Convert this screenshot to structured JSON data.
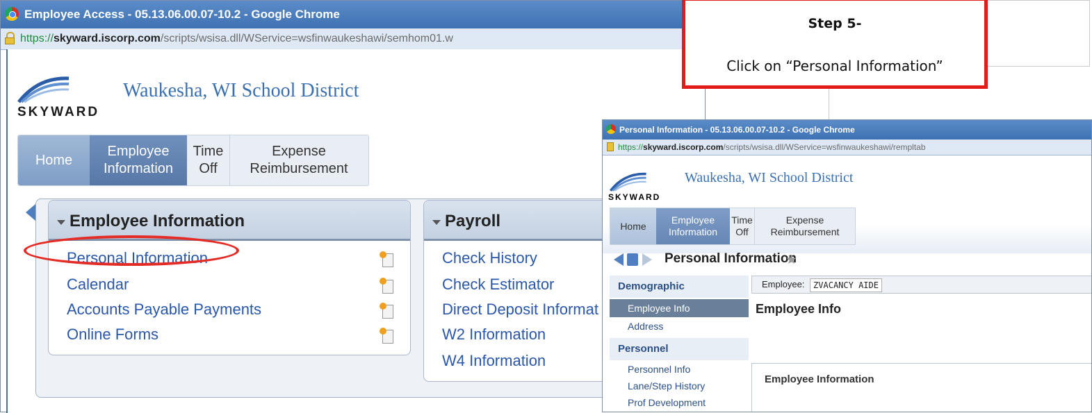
{
  "main_window": {
    "title": "Employee Access - 05.13.06.00.07-10.2 - Google Chrome",
    "url": {
      "scheme": "https://",
      "host": "skyward.iscorp.com",
      "path": "/scripts/wsisa.dll/WService=wsfinwaukeshawi/semhom01.w"
    },
    "logo_text": "SKYWARD",
    "district": "Waukesha, WI School District",
    "nav": {
      "home": "Home",
      "employee_information": "Employee Information",
      "time_off": "Time Off",
      "expense_reimbursement": "Expense Reimbursement"
    },
    "employee_box": {
      "title": "Employee Information",
      "links": [
        "Personal Information",
        "Calendar",
        "Accounts Payable Payments",
        "Online Forms"
      ]
    },
    "payroll_box": {
      "title": "Payroll",
      "links": [
        "Check History",
        "Check Estimator",
        "Direct Deposit Informat",
        "W2 Information",
        "W4 Information"
      ]
    }
  },
  "callout": {
    "title": "Step 5-",
    "text": "Click on “Personal Information”",
    "border_color": "#e21b1b"
  },
  "popup_window": {
    "title": "Personal Information - 05.13.06.00.07-10.2 - Google Chrome",
    "url": {
      "scheme": "https://",
      "host": "skyward.iscorp.com",
      "path": "/scripts/wsisa.dll/WService=wsfinwaukeshawi/rempltab"
    },
    "logo_text": "SKYWARD",
    "district": "Waukesha, WI School District",
    "nav": {
      "home": "Home",
      "employee_information": "Employee Information",
      "time_off": "Time Off",
      "expense_reimbursement": "Expense Reimbursement"
    },
    "page_title": "Personal Information",
    "sidebar": {
      "demographic": "Demographic",
      "employee_info": "Employee Info",
      "address": "Address",
      "personnel": "Personnel",
      "personnel_info": "Personnel Info",
      "lane_step_history": "Lane/Step History",
      "prof_development": "Prof Development"
    },
    "employee_label": "Employee:",
    "employee_value": "ZVACANCY AIDE",
    "section_title": "Employee Info",
    "section_box_label": "Employee Information"
  }
}
